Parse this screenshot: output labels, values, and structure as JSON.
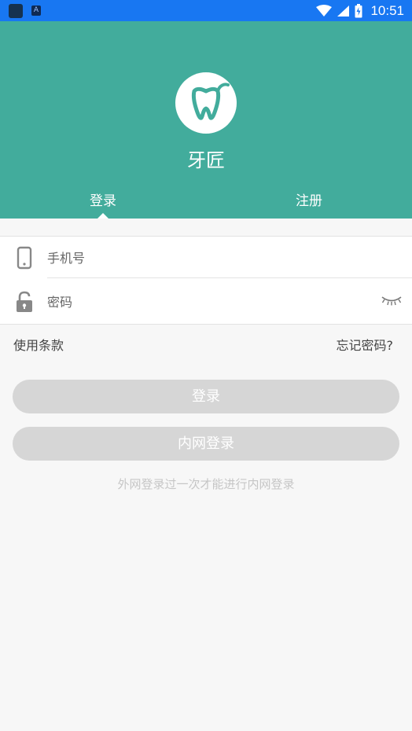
{
  "status_bar": {
    "time": "10:51",
    "app_icon": "app-notification-icon",
    "a_icon_letter": "A",
    "wifi_icon": "wifi-icon",
    "signal_icon": "cell-signal-icon",
    "battery_icon": "battery-icon",
    "color": "#1877f2"
  },
  "header": {
    "app_name": "牙匠",
    "logo_icon": "tooth-logo-icon",
    "background": "#42ac9c",
    "tabs": [
      {
        "label": "登录",
        "active": true
      },
      {
        "label": "注册",
        "active": false
      }
    ]
  },
  "form": {
    "phone": {
      "icon": "phone-icon",
      "placeholder": "手机号",
      "value": ""
    },
    "password": {
      "icon": "lock-icon",
      "placeholder": "密码",
      "value": "",
      "toggle_icon": "eye-closed-icon"
    }
  },
  "links": {
    "terms": "使用条款",
    "forgot_password": "忘记密码?"
  },
  "buttons": {
    "login": "登录",
    "intranet_login": "内网登录"
  },
  "hint": "外网登录过一次才能进行内网登录"
}
